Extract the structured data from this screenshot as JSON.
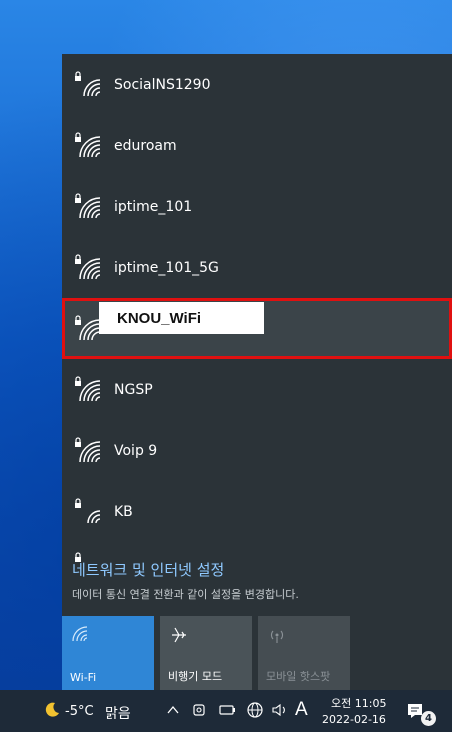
{
  "networks": [
    {
      "name": "SocialNS1290",
      "secured": true
    },
    {
      "name": "eduroam",
      "secured": true
    },
    {
      "name": "iptime_101",
      "secured": true
    },
    {
      "name": "iptime_101_5G",
      "secured": true
    },
    {
      "name": "",
      "secured": true
    },
    {
      "name": "NGSP",
      "secured": true
    },
    {
      "name": "Voip 9",
      "secured": true
    },
    {
      "name": "KB",
      "secured": true
    }
  ],
  "highlighted_network": "KNOU_WiFi",
  "settings": {
    "link": "네트워크 및 인터넷 설정",
    "subtitle": "데이터 통신 연결 전환과 같이 설정을 변경합니다."
  },
  "quick_actions": {
    "wifi": "Wi-Fi",
    "airplane": "비행기 모드",
    "hotspot": "모바일 핫스팟"
  },
  "taskbar": {
    "temperature": "-5°C",
    "weather": "맑음",
    "ime": "A",
    "time": "오전 11:05",
    "date": "2022-02-16",
    "notification_count": "4"
  },
  "colors": {
    "accent": "#2f86d6",
    "highlight_border": "#e01010",
    "panel": "#2b3338"
  }
}
